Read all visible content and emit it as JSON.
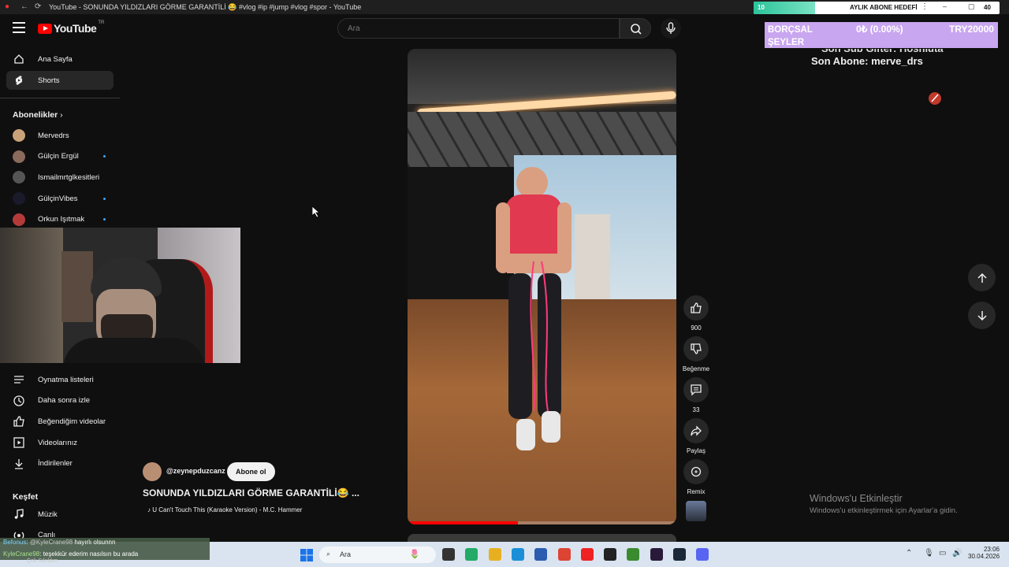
{
  "window": {
    "title": "YouTube - SONUNDA YILDIZLARI GÖRME GARANTİLİ 😂 #vlog #ip #jump #vlog #spor - YouTube"
  },
  "header": {
    "logo_text": "YouTube",
    "country_code": "TR",
    "search_placeholder": "Ara"
  },
  "sidebar": {
    "home_label": "Ana Sayfa",
    "shorts_label": "Shorts",
    "subs_heading": "Abonelikler",
    "subs": [
      {
        "name": "Mervedrs",
        "color": "#caa27a",
        "new": false
      },
      {
        "name": "Gülçin Ergül",
        "color": "#8a6a5a",
        "new": true
      },
      {
        "name": "Ismailmrtglkesitleri",
        "color": "#555555",
        "new": false
      },
      {
        "name": "GülçinVibes",
        "color": "#1a1a2a",
        "new": true
      },
      {
        "name": "Orkun Işıtmak",
        "color": "#b43a3a",
        "new": true
      }
    ],
    "you_items": [
      {
        "label": "Oynatma listeleri",
        "icon": "playlist-icon"
      },
      {
        "label": "Daha sonra izle",
        "icon": "clock-icon"
      },
      {
        "label": "Beğendiğim videolar",
        "icon": "thumbs-up-icon"
      },
      {
        "label": "Videolarınız",
        "icon": "video-icon"
      },
      {
        "label": "İndirilenler",
        "icon": "download-icon"
      }
    ],
    "explore_heading": "Keşfet",
    "explore_items": [
      {
        "label": "Müzik",
        "icon": "music-icon"
      },
      {
        "label": "Canlı",
        "icon": "live-icon"
      }
    ]
  },
  "short": {
    "channel": "@zeynepduzcanz",
    "subscribe_label": "Abone ol",
    "title": "SONUNDA YILDIZLARI GÖRME GARANTİLİ😂 ...",
    "sound": "U Can't Touch This (Karaoke Version) - M.C. Hammer",
    "progress_fraction": 0.41
  },
  "actions": {
    "like_count": "900",
    "dislike_label": "Beğenme",
    "comment_count": "33",
    "share_label": "Paylaş",
    "remix_label": "Remix"
  },
  "overlay": {
    "goal_label": "AYLIK ABONE HEDEFİ",
    "goal_count": "10",
    "goal_end": "40",
    "goal_fraction": 0.25,
    "left_text": "BORÇSAL ŞEYLER",
    "mid_text": "0₺ (0.00%)",
    "right_text": "TRY20000",
    "last_sub_gift": "Son Sub Gifter: Hoshiuta",
    "last_sub": "Son Abone: merve_drs"
  },
  "activate_windows": {
    "title": "Windows'u Etkinleştir",
    "subtitle": "Windows'u etkinleştirmek için Ayarlar'a gidin."
  },
  "taskbar": {
    "search_text": "Ara",
    "time": "23:06",
    "date": "30.04.2026"
  },
  "chat": {
    "line1_user": "Befonus",
    "line1_mention": "@KyleCrane98",
    "line1_text": "hayırlı olsunnn",
    "line2_user": "KyleCrane98",
    "line2_text": "teşekkür ederim nasılsın bu arada",
    "line3_text": "Çok Sıkıldım"
  },
  "colors": {
    "accent_red": "#ff0000",
    "new_dot": "#3ea6ff",
    "goal_purple": "#c9a6f0"
  }
}
